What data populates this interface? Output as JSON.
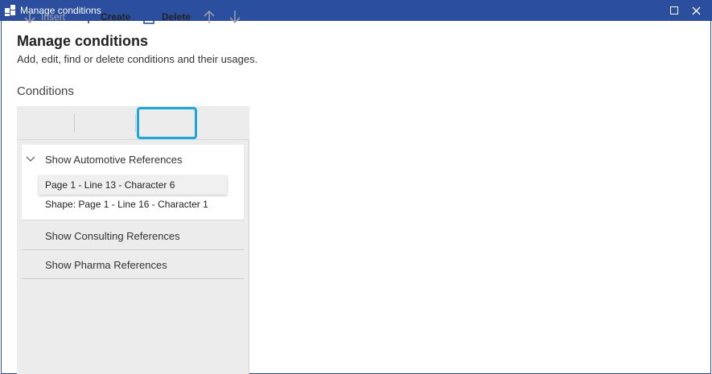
{
  "window": {
    "title": "Manage conditions",
    "icon": "app-grid-icon",
    "maximize_icon": "maximize-icon",
    "close_icon": "close-icon"
  },
  "header": {
    "title": "Manage conditions",
    "subtitle": "Add, edit, find or delete conditions and their usages."
  },
  "conditions": {
    "heading": "Conditions",
    "toolbar": {
      "insert": {
        "label": "Insert",
        "icon": "arrow-down-icon",
        "enabled": false
      },
      "create": {
        "label": "Create",
        "icon": "plus-icon",
        "enabled": true
      },
      "delete": {
        "label": "Delete",
        "icon": "clipboard-delete-icon",
        "enabled": true,
        "highlighted": true
      },
      "move_up": {
        "icon": "arrow-up-icon",
        "enabled": false
      },
      "move_down": {
        "icon": "arrow-down-icon",
        "enabled": false
      }
    },
    "groups": [
      {
        "label": "Show Automotive References",
        "expanded": true,
        "usages": [
          {
            "label": "Page 1 - Line 13 - Character 6",
            "selected": true
          },
          {
            "label": "Shape: Page 1 - Line 16 - Character 1",
            "selected": false
          }
        ]
      },
      {
        "label": "Show Consulting References",
        "expanded": false
      },
      {
        "label": "Show Pharma References",
        "expanded": false
      }
    ]
  },
  "colors": {
    "titlebar": "#2b4f9e",
    "highlight": "#1aa8dc",
    "accent_icon": "#2b4f9e"
  }
}
